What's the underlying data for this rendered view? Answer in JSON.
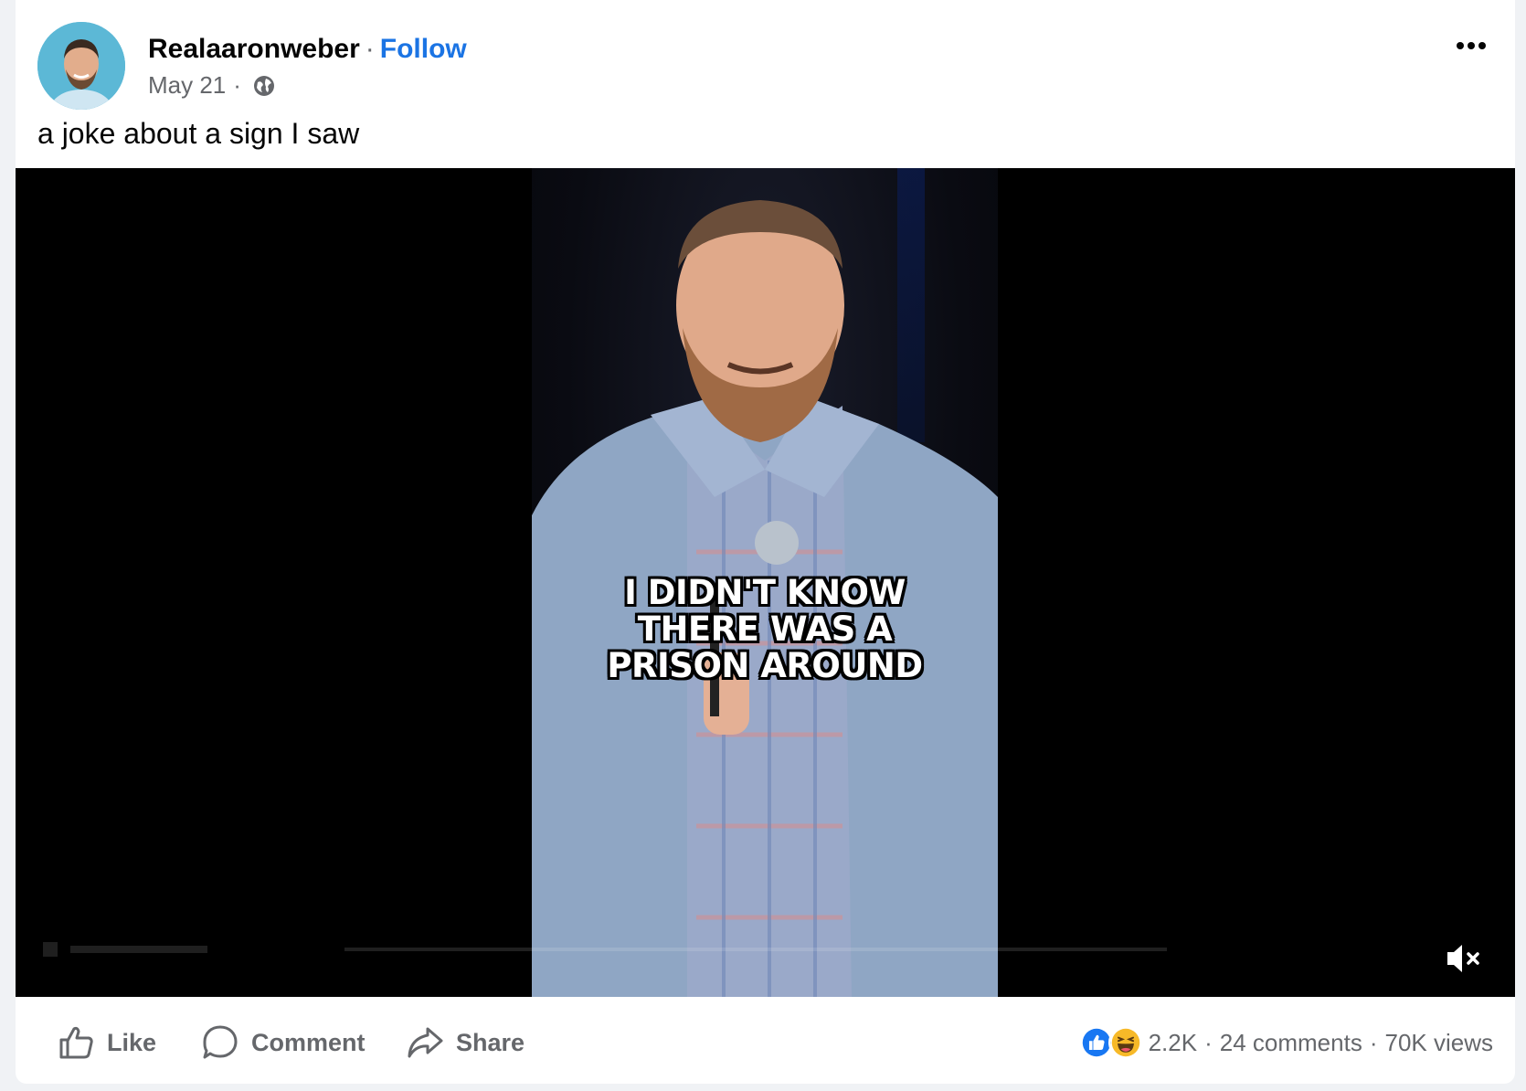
{
  "post": {
    "author": "Realaaronweber",
    "separator": "·",
    "follow_label": "Follow",
    "date": "May 21",
    "date_separator": "·",
    "audience_icon": "globe-icon",
    "more_icon": "more-options-icon",
    "caption": "a joke about a sign I saw"
  },
  "video": {
    "subtitle": "I DIDN'T KNOW\nTHERE WAS A\nPRISON AROUND",
    "muted": true,
    "mute_icon": "muted-speaker-icon"
  },
  "actions": {
    "like_label": "Like",
    "comment_label": "Comment",
    "share_label": "Share"
  },
  "stats": {
    "reaction_icons": [
      "like-reaction-icon",
      "haha-reaction-icon"
    ],
    "reaction_count": "2.2K",
    "separator": "·",
    "comments": "24 comments",
    "views": "70K views"
  },
  "colors": {
    "link_blue": "#1b74e4",
    "secondary_text": "#65676b",
    "primary_text": "#050505",
    "like_blue": "#1877f2",
    "haha_yellow": "#f7b928"
  }
}
